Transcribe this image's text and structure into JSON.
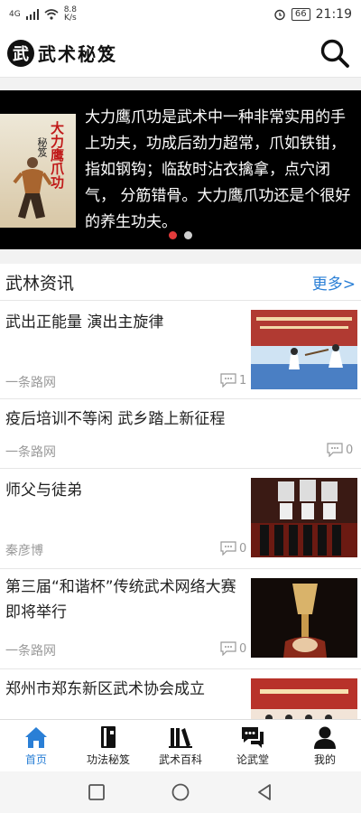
{
  "status": {
    "network": "4G",
    "speed_value": "8.8",
    "speed_unit": "K/s",
    "battery": "66",
    "time": "21:19"
  },
  "header": {
    "logo_char": "武",
    "app_name": "武术秘笈"
  },
  "banner": {
    "book_title": "大力鹰爪功",
    "book_sub": "秘笈",
    "text": "大力鹰爪功是武术中一种非常实用的手上功夫，功成后劲力超常，爪如铁钳，指如钢钩；临敌时沾衣擒拿，点穴闭气， 分筋错骨。大力鹰爪功还是个很好的养生功夫。",
    "slide_count": 2,
    "active_slide": 1
  },
  "news": {
    "title": "武林资讯",
    "more": "更多>",
    "items": [
      {
        "title": "武出正能量 演出主旋律",
        "source": "一条路网",
        "comments": "1",
        "has_image": true
      },
      {
        "title": "疫后培训不等闲 武乡踏上新征程",
        "source": "一条路网",
        "comments": "0",
        "has_image": false
      },
      {
        "title": "师父与徒弟",
        "source": "秦彦博",
        "comments": "0",
        "has_image": true
      },
      {
        "title": "第三届“和谐杯”传统武术网络大赛 即将举行",
        "source": "一条路网",
        "comments": "0",
        "has_image": true
      },
      {
        "title": "郑州市郑东新区武术协会成立",
        "source": "",
        "comments": "",
        "has_image": true
      }
    ]
  },
  "bottom_nav": [
    {
      "label": "首页",
      "icon": "home-icon",
      "active": true
    },
    {
      "label": "功法秘笈",
      "icon": "book-icon",
      "active": false
    },
    {
      "label": "武术百科",
      "icon": "library-icon",
      "active": false
    },
    {
      "label": "论武堂",
      "icon": "chat-icon",
      "active": false
    },
    {
      "label": "我的",
      "icon": "user-icon",
      "active": false
    }
  ],
  "colors": {
    "accent": "#2a7fd6",
    "banner_bg": "#000000",
    "dot_active": "#e23b3b"
  }
}
